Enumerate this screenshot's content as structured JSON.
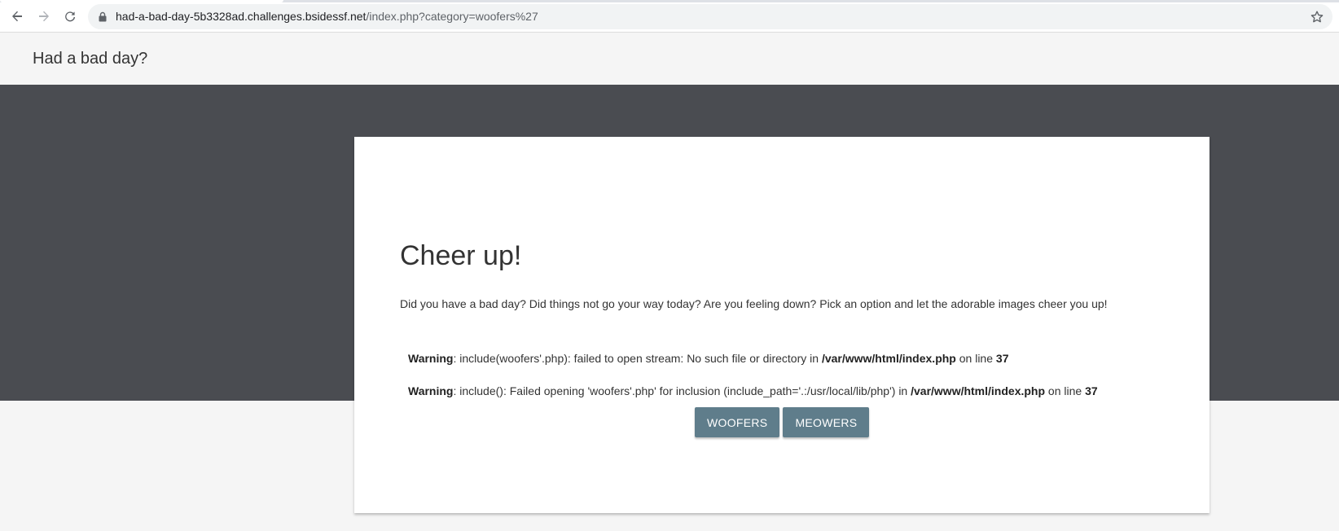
{
  "browser": {
    "url_host": "had-a-bad-day-5b3328ad.challenges.bsidessf.net",
    "url_path": "/index.php?category=woofers%27",
    "icons": {
      "back": "back-arrow-icon",
      "forward": "forward-arrow-icon",
      "reload": "reload-icon",
      "lock": "lock-icon",
      "bookmark": "star-icon"
    }
  },
  "header": {
    "title": "Had a bad day?"
  },
  "card": {
    "title": "Cheer up!",
    "intro": "Did you have a bad day? Did things not go your way today? Are you feeling down? Pick an option and let the adorable images cheer you up!",
    "warnings": [
      {
        "label": "Warning",
        "message": ": include(woofers'.php): failed to open stream: No such file or directory in ",
        "file": "/var/www/html/index.php",
        "line_text": " on line ",
        "line": "37"
      },
      {
        "label": "Warning",
        "message": ": include(): Failed opening 'woofers'.php' for inclusion (include_path='.:/usr/local/lib/php') in ",
        "file": "/var/www/html/index.php",
        "line_text": " on line ",
        "line": "37"
      }
    ],
    "buttons": {
      "woofers": "WOOFERS",
      "meowers": "MEOWERS"
    }
  },
  "colors": {
    "band": "#4a4c51",
    "button": "#5f7d8b",
    "page_bg": "#f5f5f5"
  }
}
